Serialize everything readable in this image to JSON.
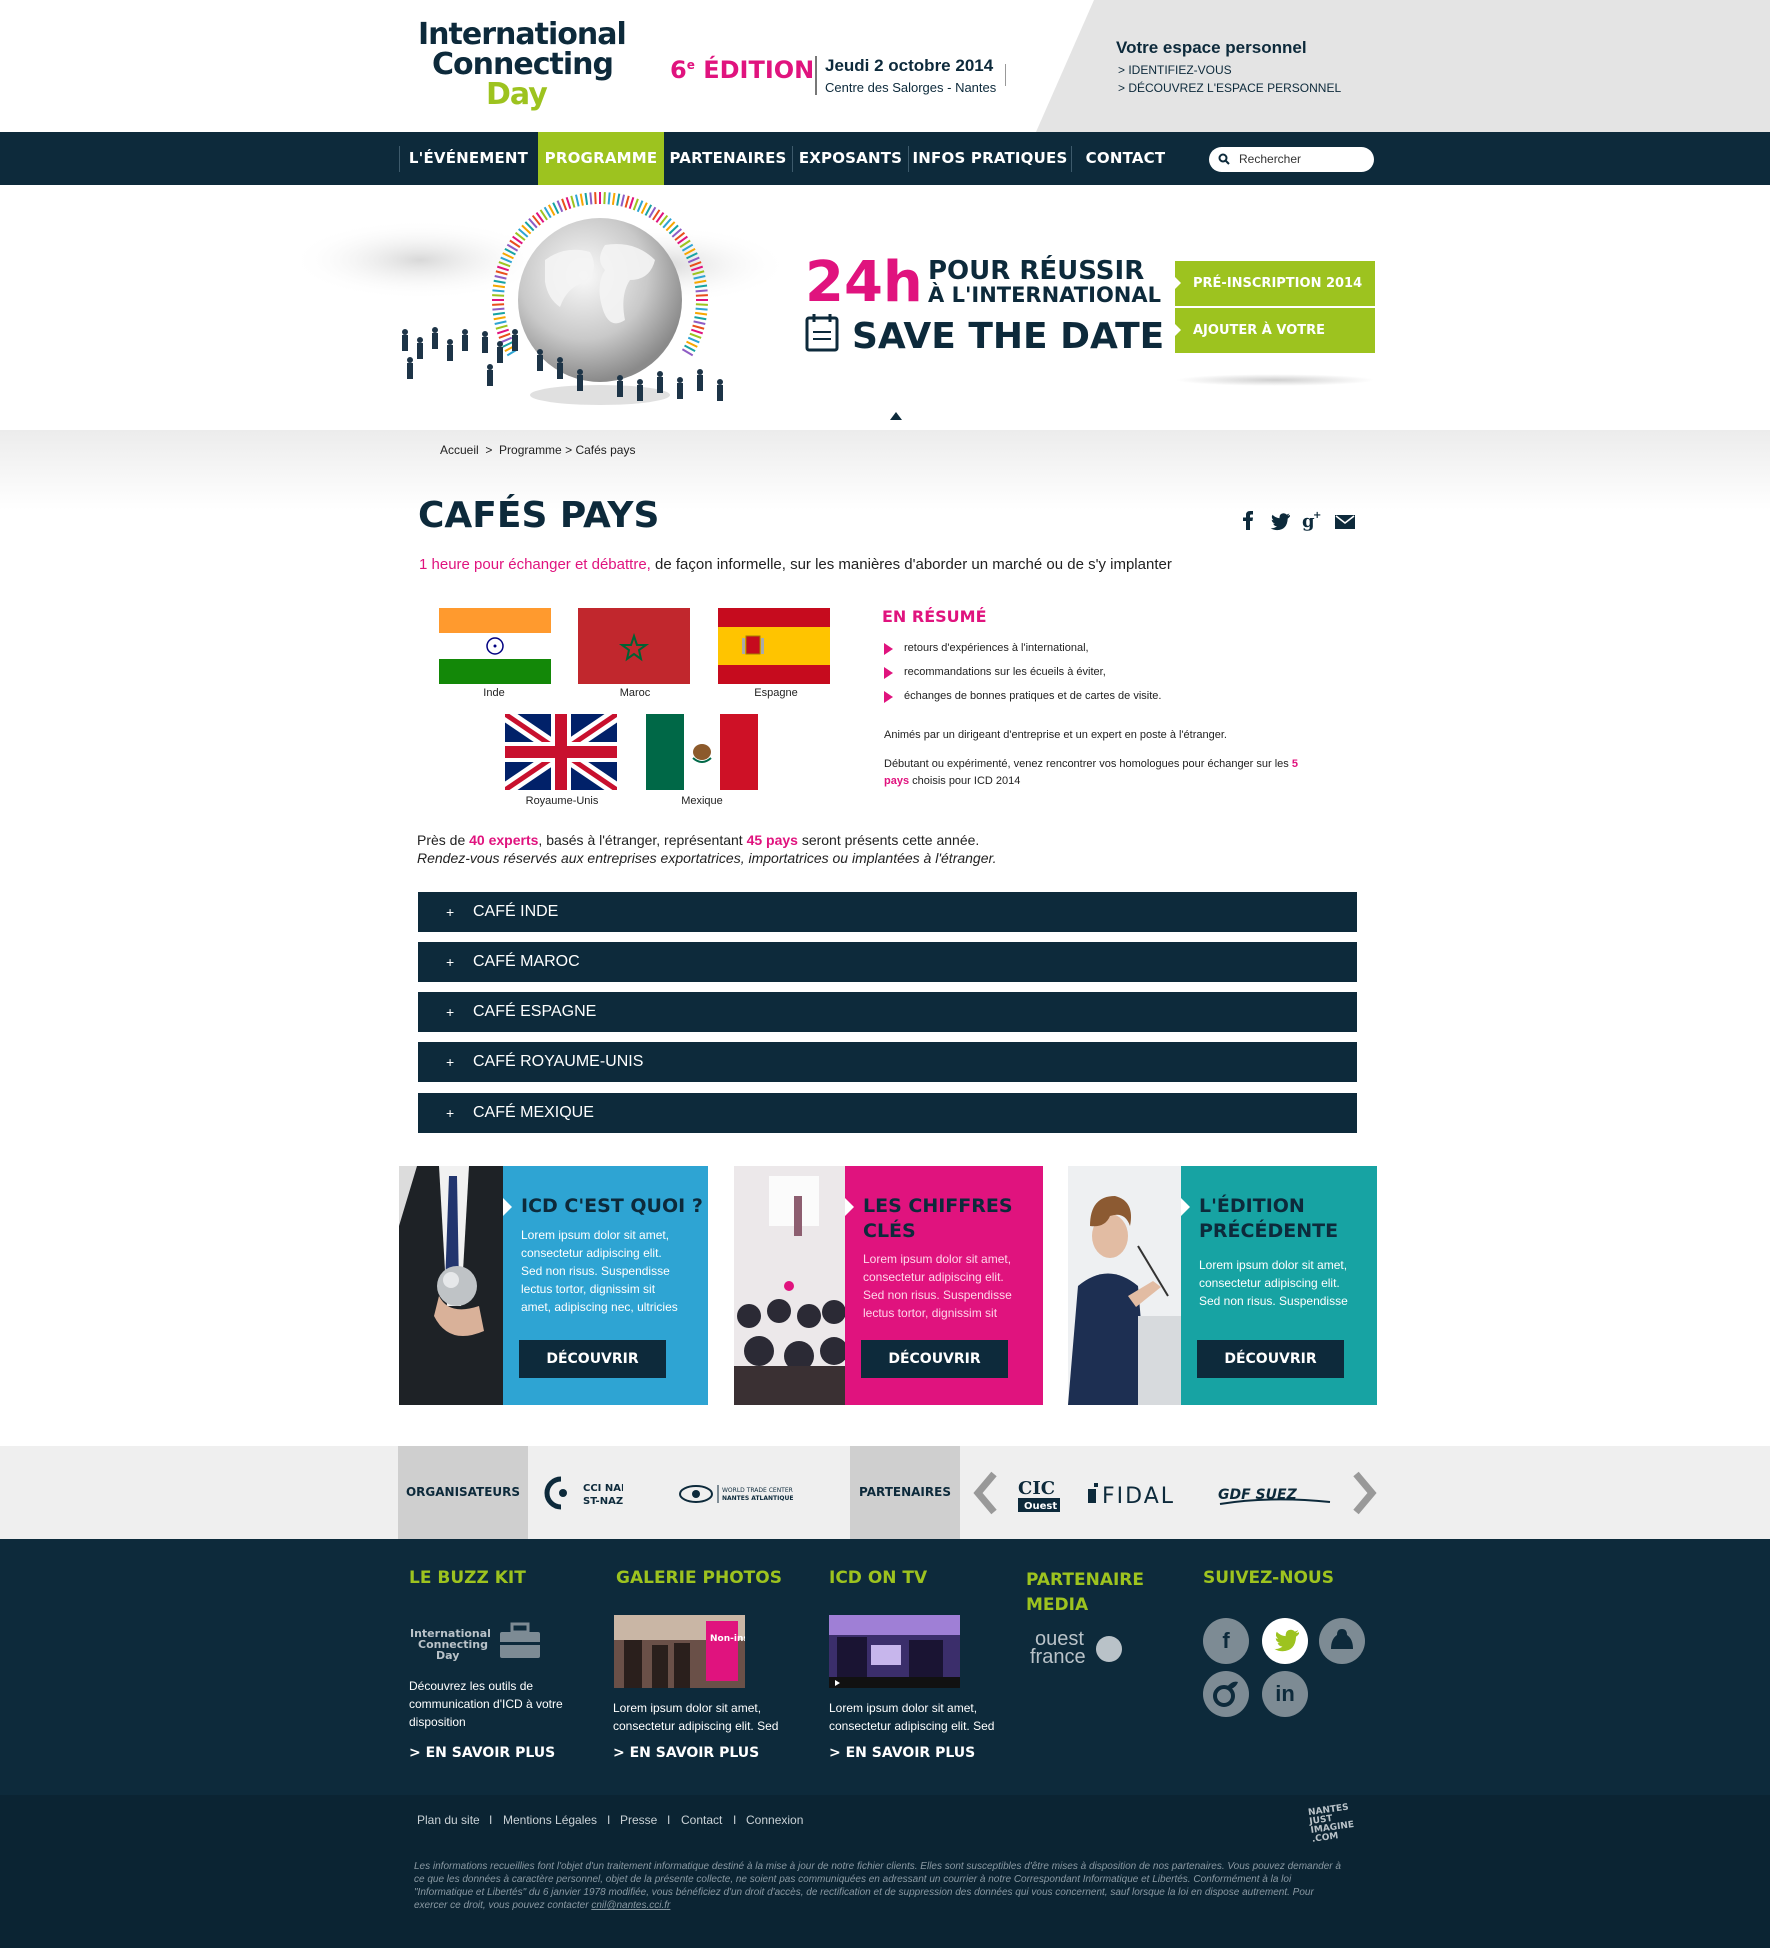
{
  "header": {
    "logo": {
      "line1": "International",
      "line2": "Connecting",
      "line3": "Day"
    },
    "edition_num": "6",
    "edition_sup": "e",
    "edition_label": "ÉDITION",
    "date": "Jeudi 2 octobre 2014",
    "place": "Centre des Salorges - Nantes",
    "espace_title": "Votre espace personnel",
    "espace_links": [
      "> IDENTIFIEZ-VOUS",
      "> DÉCOUVREZ L'ESPACE PERSONNEL"
    ]
  },
  "nav": {
    "items": [
      "L'ÉVÉNEMENT",
      "PROGRAMME",
      "PARTENAIRES",
      "EXPOSANTS",
      "INFOS PRATIQUES",
      "CONTACT"
    ],
    "active": "PROGRAMME",
    "search_placeholder": "Rechercher"
  },
  "hero": {
    "h24": "24h",
    "line1": "POUR RÉUSSIR",
    "line2": "À L'INTERNATIONAL",
    "save": "SAVE THE DATE",
    "buttons": [
      "PRÉ-INSCRIPTION 2014",
      "AJOUTER À VOTRE AGENDA"
    ]
  },
  "breadcrumb": {
    "home": "Accueil",
    "sep1": ">",
    "section": "Programme",
    "sep2": ">",
    "current": "Cafés pays"
  },
  "page": {
    "title": "CAFÉS PAYS",
    "share_icons": [
      "facebook-icon",
      "twitter-icon",
      "google-plus-icon",
      "mail-icon"
    ],
    "intro_highlight": "1 heure pour échanger et débattre,",
    "intro_rest": " de façon informelle, sur les manières d'aborder un marché ou de s'y implanter",
    "flags": [
      "Inde",
      "Maroc",
      "Espagne",
      "Royaume-Unis",
      "Mexique"
    ],
    "resume_title": "EN RÉSUMÉ",
    "resume_items": [
      "retours d'expériences à l'international,",
      "recommandations sur les écueils à éviter,",
      "échanges de bonnes pratiques et de cartes de visite."
    ],
    "resume_p1": "Animés par un dirigeant d'entreprise et un expert en poste à l'étranger.",
    "resume_p2_a": "Débutant ou expérimenté, venez rencontrer vos homologues pour échanger sur les ",
    "resume_p2_b": "5 pays",
    "resume_p2_c": " choisis pour ICD 2014",
    "experts_a": "Près de ",
    "experts_b": "40 experts",
    "experts_c": ", basés à l'étranger, représentant ",
    "experts_d": "45 pays",
    "experts_e": " seront présents cette année.",
    "experts_line2": "Rendez-vous réservés aux entreprises exportatrices, importatrices ou implantées à l'étranger.",
    "accordion": [
      "CAFÉ INDE",
      "CAFÉ MAROC",
      "CAFÉ ESPAGNE",
      "CAFÉ ROYAUME-UNIS",
      "CAFÉ MEXIQUE"
    ],
    "accordion_icon": "+"
  },
  "promos": [
    {
      "title": "ICD C'EST QUOI ?",
      "text": [
        "Lorem ipsum dolor sit amet,",
        "consectetur adipiscing elit.",
        "Sed non risus. Suspendisse",
        "lectus tortor, dignissim sit",
        "amet, adipiscing nec, ultricies"
      ],
      "button": "DÉCOUVRIR",
      "color": "#2ea4d3"
    },
    {
      "title": "LES CHIFFRES CLÉS",
      "text": [
        "Lorem ipsum dolor sit amet,",
        "consectetur adipiscing elit.",
        "Sed non risus. Suspendisse",
        "lectus tortor, dignissim sit"
      ],
      "button": "DÉCOUVRIR",
      "color": "#e0137e"
    },
    {
      "title": "L'ÉDITION PRÉCÉDENTE",
      "text": [
        "Lorem ipsum dolor sit amet,",
        "consectetur adipiscing elit.",
        "Sed non risus. Suspendisse"
      ],
      "button": "DÉCOUVRIR",
      "color": "#17a3a3"
    }
  ],
  "partners_bar": {
    "organisateurs_label": "ORGANISATEURS",
    "partenaires_label": "PARTENAIRES",
    "org_logos": [
      "CCI NANTES",
      "ST-NAZAIRE",
      "WORLD TRADE CENTER",
      "NANTES ATLANTIQUE"
    ],
    "partner_logos": [
      "CIC",
      "Ouest",
      "FIDAL",
      "GDF SUEZ"
    ]
  },
  "footer": {
    "buzz_title": "LE BUZZ KIT",
    "buzz_logo": [
      "International",
      "Connecting",
      "Day"
    ],
    "buzz_text": [
      "Découvrez les outils de",
      "communication d'ICD à votre",
      "disposition"
    ],
    "galerie_title": "GALERIE PHOTOS",
    "galerie_text": [
      "Lorem ipsum dolor sit amet,",
      "consectetur adipiscing elit. Sed"
    ],
    "galerie_badge": "Non-inscrits",
    "tv_title": "ICD ON TV",
    "tv_text": [
      "Lorem ipsum dolor sit amet,",
      "consectetur adipiscing elit. Sed"
    ],
    "media_title_1": "PARTENAIRE",
    "media_title_2": "MEDIA",
    "media_logo": [
      "ouest",
      "france"
    ],
    "suivez_title": "SUIVEZ-NOUS",
    "more": "> EN SAVOIR PLUS",
    "links": [
      "Plan du site",
      "Mentions Légales",
      "Presse",
      "Contact",
      "Connexion"
    ],
    "link_sep": "I",
    "nji": [
      "NANTES",
      "JUST",
      "IMAGINE",
      ".COM"
    ],
    "legal": "Les informations recueillies font l'objet d'un traitement informatique destiné à la mise à jour de notre fichier clients. Elles sont susceptibles d'être mises à disposition de nos partenaires. Vous pouvez demander à ce que les données à caractère personnel, objet de la présente collecte, ne soient pas communiquées en adressant un courrier à notre Correspondant Informatique et Libertés. Conformément à la loi \"Informatique et Libertés\" du 6 janvier 1978 modifiée, vous bénéficiez d'un droit d'accès, de rectification et de suppression des données qui vous concernent, sauf lorsque la loi en dispose autrement. Pour exercer ce droit, vous pouvez contacter ",
    "legal_email": "cnil@nantes.cci.fr"
  },
  "colors": {
    "navy": "#0d2a3b",
    "lime": "#9dc31f",
    "pink": "#e0137e",
    "blue": "#2ea4d3",
    "teal": "#17a3a3"
  }
}
